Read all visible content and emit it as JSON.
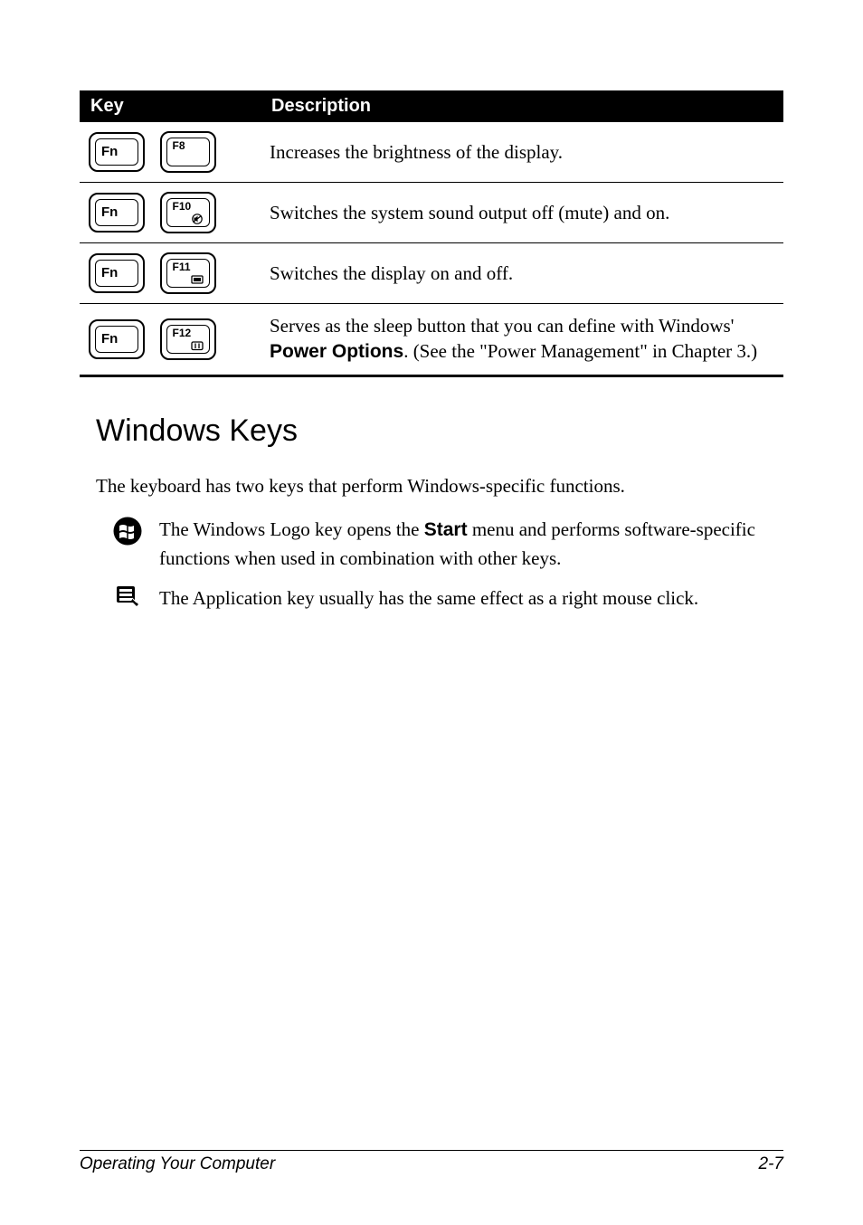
{
  "table": {
    "headers": {
      "key": "Key",
      "desc": "Description"
    },
    "rows": [
      {
        "k1": "Fn",
        "k2_top": "F8",
        "k2_icon": "",
        "desc": "Increases the brightness of the display."
      },
      {
        "k1": "Fn",
        "k2_top": "F10",
        "k2_icon": "speaker-mute",
        "desc": "Switches the system sound output off (mute) and on."
      },
      {
        "k1": "Fn",
        "k2_top": "F11",
        "k2_icon": "panel",
        "desc": "Switches the display on and off."
      },
      {
        "k1": "Fn",
        "k2_top": "F12",
        "k2_icon": "sleep",
        "desc_pre": "Serves as the sleep button",
        "desc_mid": " that you can define with Windows' ",
        "desc_bold": "Power Options",
        "desc_post": ". (See the \"Power Management\" in Chapter 3.)"
      }
    ]
  },
  "heading_windows_keys": "Windows Keys",
  "paragraph_intro": "The keyboard has two keys that perform Windows-specific functions.",
  "win_rows": [
    {
      "icon": "windows-logo",
      "pre": "The Windows Logo key opens the ",
      "bold": "Start",
      "post": " menu and performs software-specific functions when used in combination with other keys."
    },
    {
      "icon": "application-key",
      "text": "The Application key usually has the same effect as a right mouse click."
    }
  ],
  "footer": {
    "left": "Operating Your Computer",
    "right": "2-7"
  }
}
